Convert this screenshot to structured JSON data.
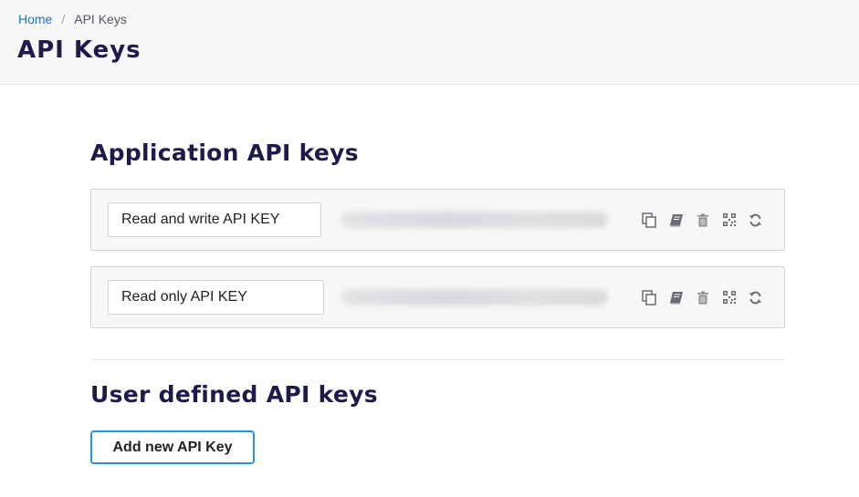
{
  "breadcrumb": {
    "home": "Home",
    "separator": "/",
    "current": "API Keys"
  },
  "page": {
    "title": "API Keys"
  },
  "application_keys": {
    "title": "Application API keys",
    "rows": [
      {
        "name": "Read and write API KEY"
      },
      {
        "name": "Read only API KEY"
      }
    ],
    "action_icons": [
      "copy-icon",
      "book-icon",
      "trash-icon",
      "qr-code-icon",
      "refresh-icon"
    ]
  },
  "user_keys": {
    "title": "User defined API keys",
    "add_label": "Add new API Key"
  },
  "colors": {
    "title": "#1e1b4b",
    "link": "#1a73c8",
    "button_border": "#2b8fe0",
    "icon": "#6b6b73"
  }
}
